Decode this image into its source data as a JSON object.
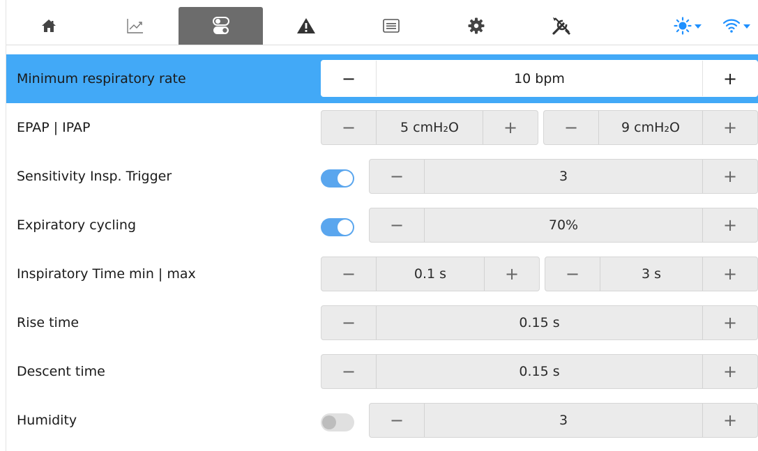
{
  "nav": {
    "tabs": [
      {
        "name": "home",
        "icon": "home-icon"
      },
      {
        "name": "trends",
        "icon": "chart-icon"
      },
      {
        "name": "settings",
        "icon": "toggle-switch-icon"
      },
      {
        "name": "alarms",
        "icon": "warning-icon"
      },
      {
        "name": "logs",
        "icon": "list-icon"
      },
      {
        "name": "configuration",
        "icon": "gear-icon"
      },
      {
        "name": "tools",
        "icon": "tools-icon"
      }
    ],
    "active_tab": "settings",
    "right": [
      {
        "icon": "brightness-icon",
        "menu": "chevron-down-icon"
      },
      {
        "icon": "wifi-icon",
        "menu": "chevron-down-icon"
      }
    ]
  },
  "colors": {
    "selected_row": "#42a9f7",
    "active_tab": "#6c6c6c",
    "toggle_on": "#5aa6ee",
    "toggle_off": "#e0e0e0",
    "accent": "#1e90ff"
  },
  "controls": {
    "minus": "−",
    "plus": "+"
  },
  "settings": [
    {
      "label": "Minimum respiratory rate",
      "selected": true,
      "values": [
        "10 bpm"
      ]
    },
    {
      "label": "EPAP | IPAP",
      "values": [
        "5 cmH₂O",
        "9 cmH₂O"
      ]
    },
    {
      "label": "Sensitivity Insp. Trigger",
      "toggle": "on",
      "values": [
        "3"
      ]
    },
    {
      "label": "Expiratory cycling",
      "toggle": "on",
      "values": [
        "70%"
      ]
    },
    {
      "label": "Inspiratory Time min | max",
      "values": [
        "0.1 s",
        "3 s"
      ]
    },
    {
      "label": "Rise time",
      "values": [
        "0.15 s"
      ]
    },
    {
      "label": "Descent time",
      "values": [
        "0.15 s"
      ]
    },
    {
      "label": "Humidity",
      "toggle": "off",
      "values": [
        "3"
      ]
    }
  ]
}
